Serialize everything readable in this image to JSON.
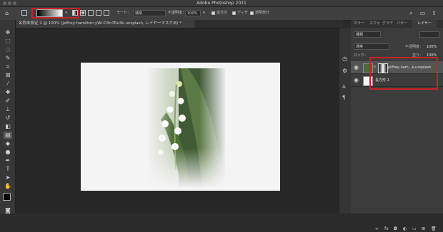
{
  "window": {
    "title": "Adobe Photoshop 2021"
  },
  "options_bar": {
    "mode_label": "モード：",
    "mode_value": "通常",
    "opacity_label": "不透明度：",
    "opacity_value": "100%",
    "reverse_label": "逆方向",
    "dither_label": "ディザ",
    "transparency_label": "透明部分"
  },
  "document_tab": {
    "label": "名称未設定 2 @ 100% (jeffrey-hamilton-yWi-D3n7Rv3k-unsplash, レイヤーマスク/8) *"
  },
  "panel": {
    "tabs": [
      "カラー",
      "スウォ",
      "グラデ",
      "パター",
      "レイヤー"
    ],
    "kind_filter": "種類",
    "blend_mode": "通常",
    "opacity_label": "不透明度：",
    "opacity_value": "100%",
    "lock_label": "ロック：",
    "fill_label": "塗り：",
    "fill_value": "100%",
    "layers": [
      {
        "name": "jeffrey-ham...k-unsplash"
      },
      {
        "name": "長方形 1"
      }
    ]
  },
  "colors": {
    "highlight": "#c8222a",
    "foreground": "#000000",
    "background": "#ffffff"
  }
}
